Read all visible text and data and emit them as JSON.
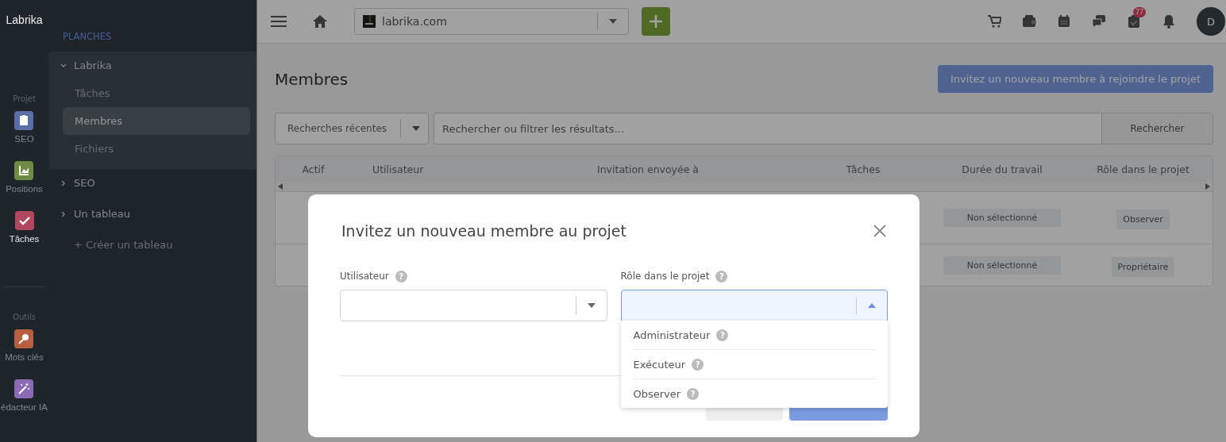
{
  "rail": {
    "logo": "Labrika",
    "sections": [
      {
        "label": "Projet",
        "items": [
          {
            "label": "SEO",
            "kind": "clipboard",
            "color": "#5a6ea8",
            "selected": false
          },
          {
            "label": "Positions",
            "kind": "chart",
            "color": "#6e8c43",
            "selected": false
          },
          {
            "label": "Tâches",
            "kind": "check",
            "color": "#b0475f",
            "selected": true
          }
        ]
      },
      {
        "label": "Outils",
        "items": [
          {
            "label": "Mots clés",
            "kind": "key",
            "color": "#b85f40",
            "selected": false
          },
          {
            "label": "édacteur IA",
            "kind": "wand",
            "color": "#8b6bb5",
            "selected": false
          }
        ]
      }
    ]
  },
  "sidebar": {
    "heading": "PLANCHES",
    "boards": [
      {
        "label": "Labrika",
        "expanded": true,
        "children": [
          {
            "label": "Tâches",
            "selected": false
          },
          {
            "label": "Membres",
            "selected": true
          },
          {
            "label": "Fichiers",
            "selected": false
          }
        ]
      },
      {
        "label": "SEO",
        "expanded": false
      },
      {
        "label": "Un tableau",
        "expanded": false
      }
    ],
    "create": "+ Créer un tableau"
  },
  "topbar": {
    "site": "labrika.com",
    "notifications_badge": "77",
    "avatar": "D"
  },
  "page": {
    "title": "Membres",
    "invite_button": "Invitez un nouveau membre à rejoindre le projet",
    "recent_searches": "Recherches récentes",
    "search": {
      "placeholder": "Rechercher ou filtrer les résultats..."
    },
    "search_button": "Rechercher"
  },
  "table": {
    "columns": [
      "Actif",
      "Utilisateur",
      "Invitation envoyée à",
      "Tâches",
      "Durée du travail",
      "Rôle dans le projet"
    ],
    "rows": [
      {
        "duration": "Non sélectionné",
        "role": "Observer"
      },
      {
        "duration": "Non sélectionné",
        "role": "Propriétaire"
      }
    ]
  },
  "modal": {
    "title": "Invitez un nouveau membre au projet",
    "fields": [
      {
        "label": "Utilisateur",
        "help": "?",
        "focused": false
      },
      {
        "label": "Rôle dans le projet",
        "help": "?",
        "focused": true
      }
    ],
    "role_options": [
      {
        "label": "Administrateur",
        "help": "?"
      },
      {
        "label": "Exécuteur",
        "help": "?"
      },
      {
        "label": "Observer",
        "help": "?"
      }
    ],
    "buttons": [
      {
        "kind": "secondary"
      },
      {
        "kind": "primary"
      }
    ]
  }
}
